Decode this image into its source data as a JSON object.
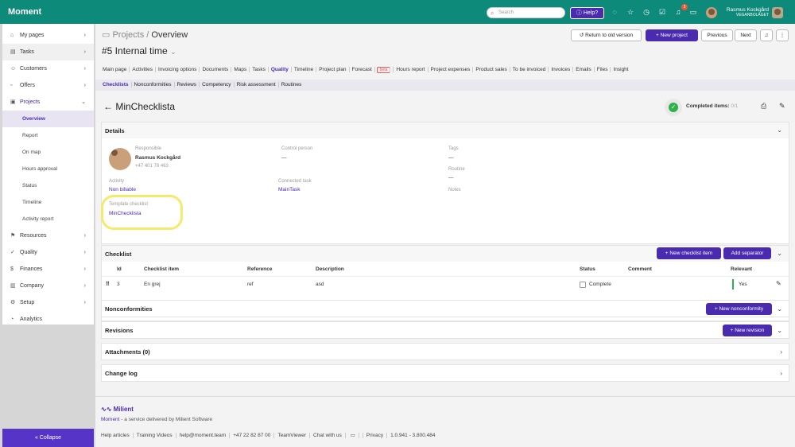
{
  "app": {
    "name": "Moment"
  },
  "topbar": {
    "search_placeholder": "Search",
    "help_label": "Help?",
    "notification_count": "3",
    "user_name": "Rasmus Kockgård",
    "user_company": "VEGANBOLAGET"
  },
  "sidebar": {
    "items": [
      {
        "label": "My pages",
        "icon": "home-icon"
      },
      {
        "label": "Tasks",
        "icon": "tasks-icon"
      },
      {
        "label": "Customers",
        "icon": "customers-icon"
      },
      {
        "label": "Offers",
        "icon": "offers-icon"
      },
      {
        "label": "Projects",
        "icon": "projects-icon"
      },
      {
        "label": "Resources",
        "icon": "resources-icon"
      },
      {
        "label": "Quality",
        "icon": "quality-icon"
      },
      {
        "label": "Finances",
        "icon": "finances-icon"
      },
      {
        "label": "Company",
        "icon": "company-icon"
      },
      {
        "label": "Setup",
        "icon": "setup-icon"
      },
      {
        "label": "Analytics",
        "icon": "analytics-icon"
      }
    ],
    "project_subitems": [
      "Overview",
      "Report",
      "On map",
      "Hours approval",
      "Status",
      "Timeline",
      "Activity report"
    ],
    "collapse_label": "Collapse"
  },
  "header": {
    "breadcrumb_root": "Projects",
    "breadcrumb_sep": "/",
    "breadcrumb_current": "Overview",
    "title": "#5 Internal time",
    "return_old_label": "Return to old version",
    "new_project_label": "+ New project",
    "previous_label": "Previous",
    "next_label": "Next"
  },
  "tabs": [
    "Main page",
    "Activities",
    "Invoicing options",
    "Documents",
    "Maps",
    "Tasks",
    "Quality",
    "Timeline",
    "Project plan",
    "Forecast",
    "Hours report",
    "Project expenses",
    "Product sales",
    "To be invoiced",
    "Invoices",
    "Emails",
    "Files",
    "Insight"
  ],
  "forecast_badge": "beta",
  "subtabs": [
    "Checklists",
    "Nonconformities",
    "Reviews",
    "Competency",
    "Risk assessment",
    "Routines"
  ],
  "checklist": {
    "back_arrow": "←",
    "title": "MinChecklista",
    "completed_label": "Completed items:",
    "completed_value": "0/1"
  },
  "details": {
    "header": "Details",
    "responsible_label": "Responsible",
    "responsible_name": "Rasmus Kockgård",
    "responsible_phone": "+47 401 78 463",
    "control_person_label": "Control person",
    "control_person_value": "—",
    "tags_label": "Tags",
    "tags_value": "—",
    "routine_label": "Routine",
    "routine_value": "—",
    "notes_label": "Notes",
    "activity_label": "Activity",
    "activity_value": "Non billable",
    "connected_task_label": "Connected task",
    "connected_task_value": "MainTask",
    "template_label": "Template checklist",
    "template_value": "MinChecklista"
  },
  "checklist_table": {
    "header": "Checklist",
    "new_item_label": "+ New checklist item",
    "add_separator_label": "Add separator",
    "columns": [
      "Id",
      "Checklist item",
      "Reference",
      "Description",
      "Status",
      "Comment",
      "Relevant"
    ],
    "rows": [
      {
        "id": "3",
        "item": "En grej",
        "reference": "ref",
        "description": "asd",
        "status": "Complete",
        "comment": "",
        "relevant": "Yes"
      }
    ]
  },
  "sections": {
    "nonconformities": "Nonconformities",
    "new_nonconformity_label": "+ New nonconformity",
    "revisions": "Revisions",
    "new_revision_label": "+ New revision",
    "attachments": "Attachments (0)",
    "changelog": "Change log"
  },
  "footer": {
    "brand": "Milient",
    "tagline_link": "Moment",
    "tagline_rest": "- a service delivered by Milient Software",
    "links": [
      "Help articles",
      "Training Videos",
      "help@moment.team",
      "+47 22 82 87 00",
      "TeamViewer",
      "Chat with us",
      "Privacy",
      "1.0.941 - 3.800.484"
    ]
  },
  "colors": {
    "accent": "#4a2bb0",
    "topbar": "#0e8a7a",
    "success": "#2bb34a",
    "highlight": "#f4ea6b"
  }
}
